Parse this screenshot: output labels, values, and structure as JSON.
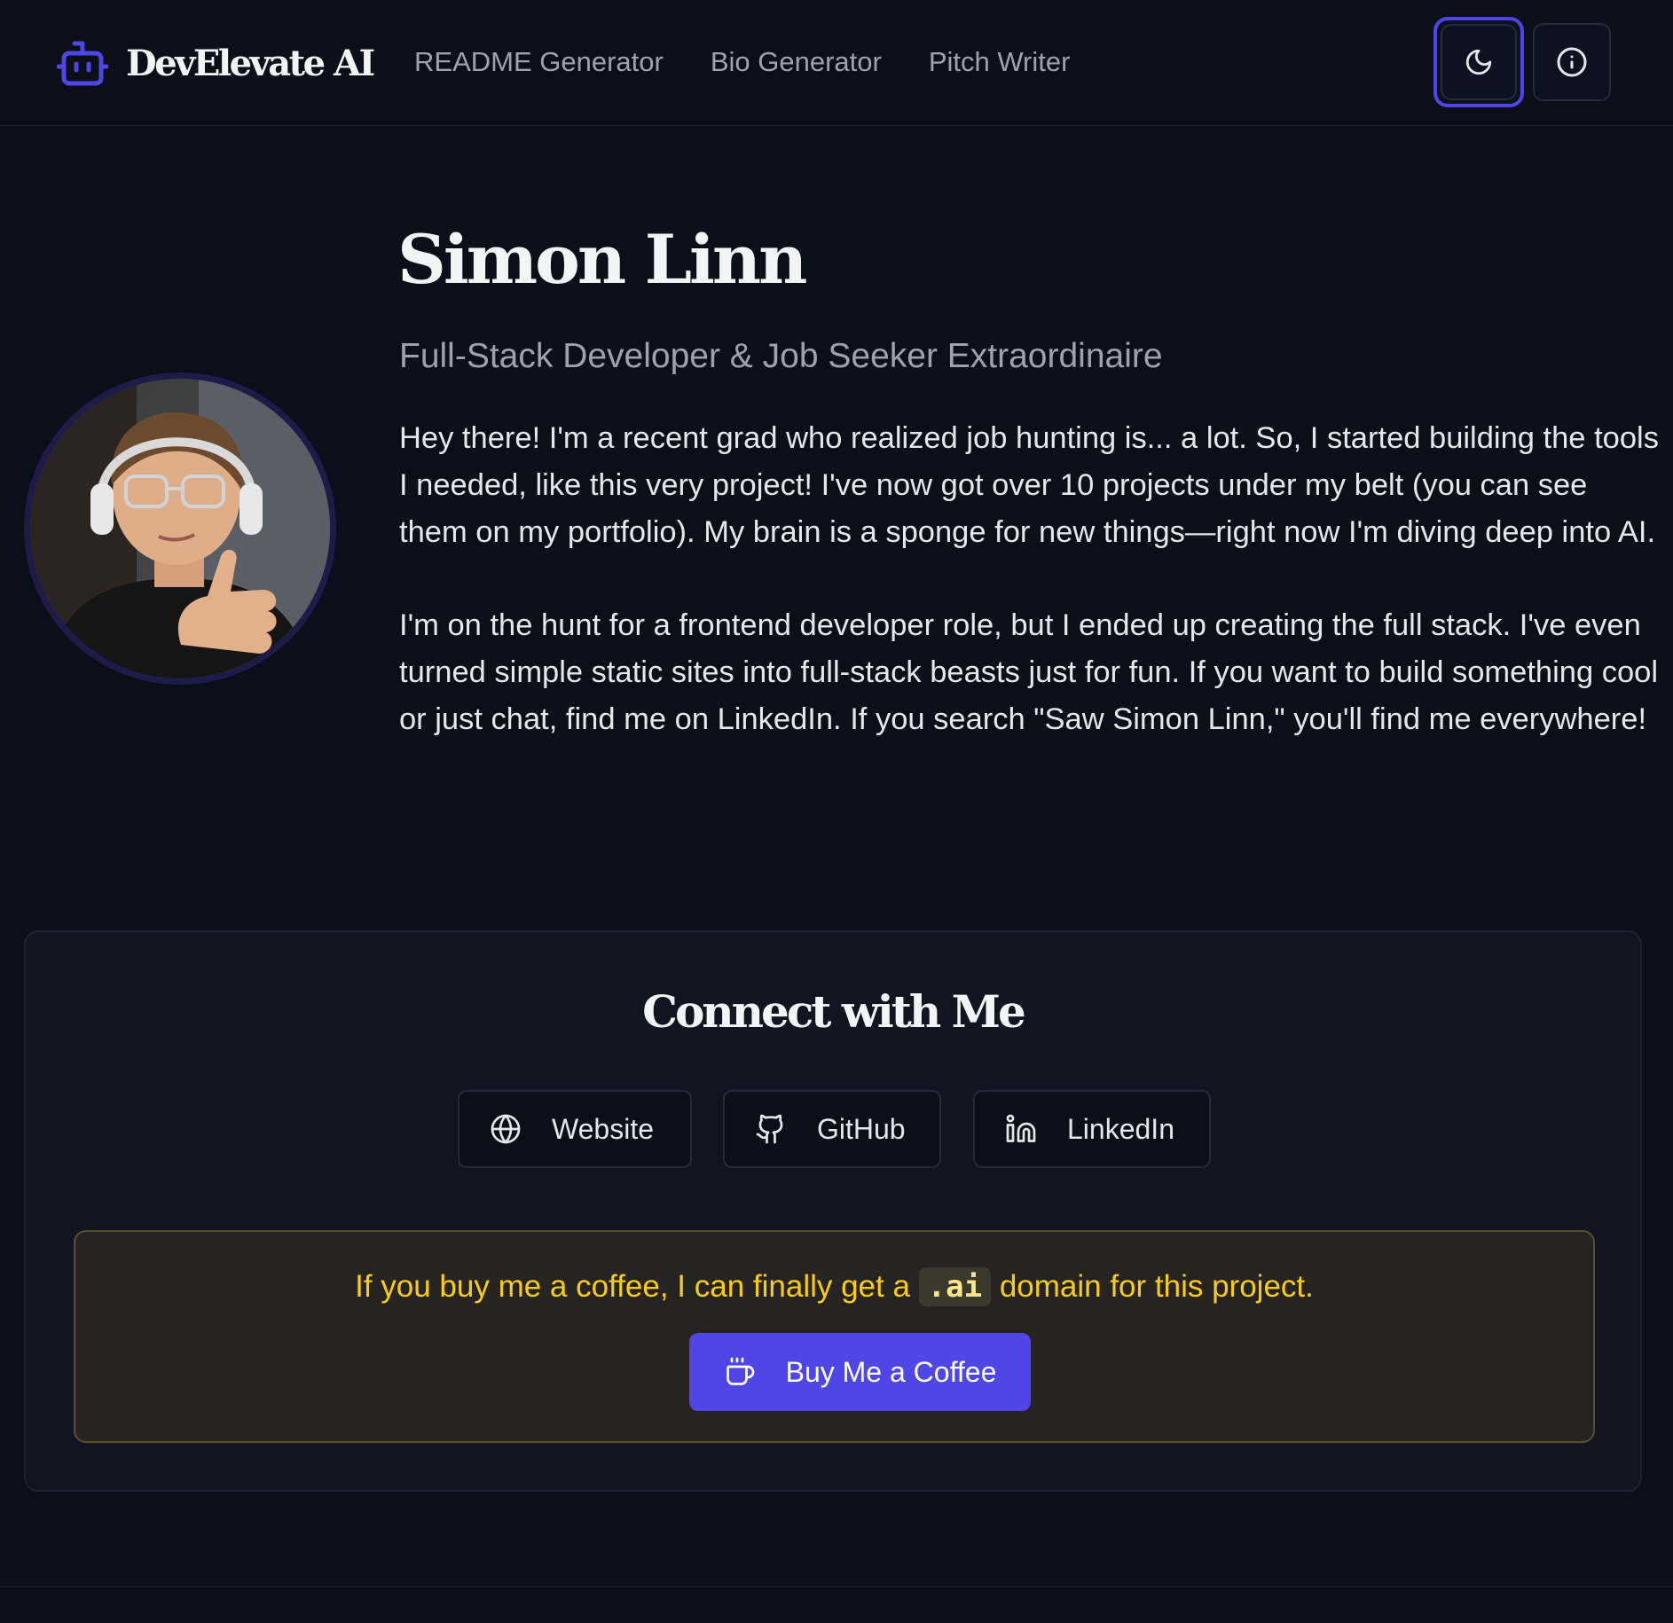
{
  "header": {
    "brand": "DevElevate AI",
    "nav": [
      "README Generator",
      "Bio Generator",
      "Pitch Writer"
    ],
    "icons": {
      "brand": "robot-icon",
      "theme": "moon-icon",
      "info": "info-icon"
    }
  },
  "profile": {
    "name": "Simon Linn",
    "subtitle": "Full-Stack Developer & Job Seeker Extraordinaire",
    "bio": [
      "Hey there! I'm a recent grad who realized job hunting is... a lot. So, I started building the tools I needed, like this very project! I've now got over 10 projects under my belt (you can see them on my portfolio). My brain is a sponge for new things—right now I'm diving deep into AI.",
      "I'm on the hunt for a frontend developer role, but I ended up creating the full stack. I've even turned simple static sites into full-stack beasts just for fun. If you want to build something cool or just chat, find me on LinkedIn. If you search \"Saw Simon Linn,\" you'll find me everywhere!"
    ]
  },
  "connect": {
    "title": "Connect with Me",
    "links": [
      {
        "label": "Website",
        "icon": "globe-icon"
      },
      {
        "label": "GitHub",
        "icon": "github-icon"
      },
      {
        "label": "LinkedIn",
        "icon": "linkedin-icon"
      }
    ],
    "coffee": {
      "text_before": "If you buy me a coffee, I can finally get a ",
      "code": ".ai",
      "text_after": " domain for this project.",
      "button_label": "Buy Me a Coffee",
      "button_icon": "coffee-cup-icon"
    }
  },
  "colors": {
    "accent": "#4f46e5",
    "background": "#0b0f1a",
    "highlight": "#facc15"
  }
}
